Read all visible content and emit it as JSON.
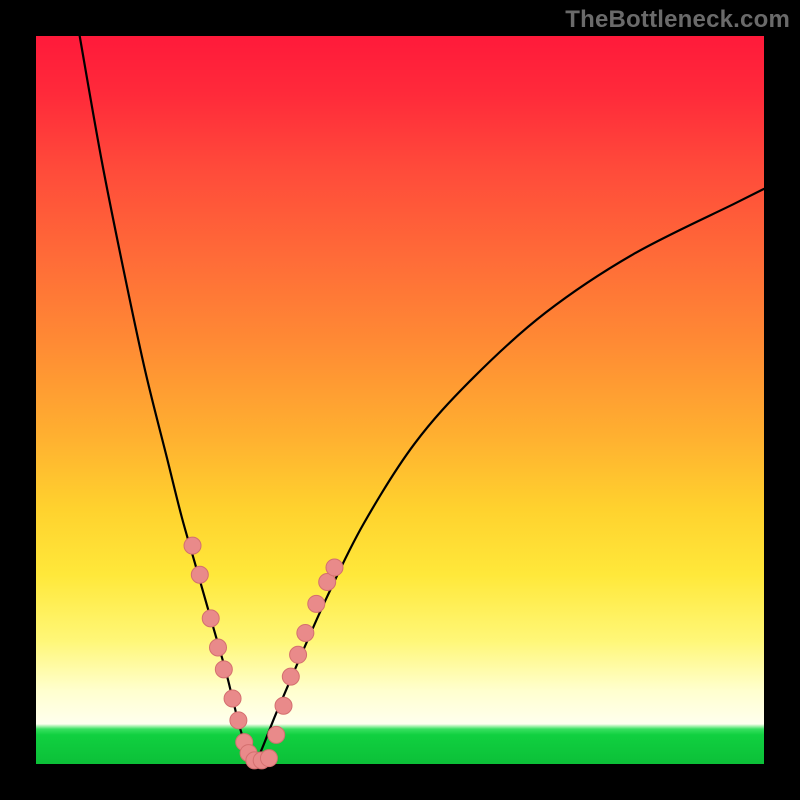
{
  "watermark": "TheBottleneck.com",
  "colors": {
    "frame": "#000000",
    "gradient_top": "#ff1a3a",
    "gradient_mid": "#ffd22e",
    "gradient_bot_band": "#10d040",
    "curve": "#000000",
    "dot_fill": "#e98a8a",
    "dot_stroke": "#d46f6f"
  },
  "chart_data": {
    "type": "line",
    "title": "",
    "xlabel": "",
    "ylabel": "",
    "xlim": [
      0,
      100
    ],
    "ylim": [
      0,
      100
    ],
    "notes": "Two monotone curves forming a V / valley. y≈0 is the green (good) band, y≈100 is red (bad). Scatter points visible only near the valley floor on both branches.",
    "series": [
      {
        "name": "left-branch",
        "x": [
          6,
          9,
          12,
          15,
          18,
          20,
          22,
          24,
          26,
          27,
          28,
          29,
          30
        ],
        "y": [
          100,
          83,
          68,
          54,
          42,
          34,
          27,
          20,
          13,
          9,
          5,
          2,
          0
        ]
      },
      {
        "name": "right-branch",
        "x": [
          30,
          31,
          33,
          36,
          40,
          45,
          52,
          60,
          70,
          82,
          96,
          100
        ],
        "y": [
          0,
          2,
          7,
          14,
          23,
          33,
          44,
          53,
          62,
          70,
          77,
          79
        ]
      }
    ],
    "scatter": [
      {
        "branch": "left",
        "x": 21.5,
        "y": 30
      },
      {
        "branch": "left",
        "x": 22.5,
        "y": 26
      },
      {
        "branch": "left",
        "x": 24.0,
        "y": 20
      },
      {
        "branch": "left",
        "x": 25.0,
        "y": 16
      },
      {
        "branch": "left",
        "x": 25.8,
        "y": 13
      },
      {
        "branch": "left",
        "x": 27.0,
        "y": 9
      },
      {
        "branch": "left",
        "x": 27.8,
        "y": 6
      },
      {
        "branch": "left",
        "x": 28.6,
        "y": 3
      },
      {
        "branch": "left",
        "x": 29.2,
        "y": 1.5
      },
      {
        "branch": "left",
        "x": 30.0,
        "y": 0.5
      },
      {
        "branch": "right",
        "x": 31.0,
        "y": 0.5
      },
      {
        "branch": "right",
        "x": 32.0,
        "y": 0.8
      },
      {
        "branch": "right",
        "x": 33.0,
        "y": 4
      },
      {
        "branch": "right",
        "x": 34.0,
        "y": 8
      },
      {
        "branch": "right",
        "x": 35.0,
        "y": 12
      },
      {
        "branch": "right",
        "x": 36.0,
        "y": 15
      },
      {
        "branch": "right",
        "x": 37.0,
        "y": 18
      },
      {
        "branch": "right",
        "x": 38.5,
        "y": 22
      },
      {
        "branch": "right",
        "x": 40.0,
        "y": 25
      },
      {
        "branch": "right",
        "x": 41.0,
        "y": 27
      }
    ]
  }
}
